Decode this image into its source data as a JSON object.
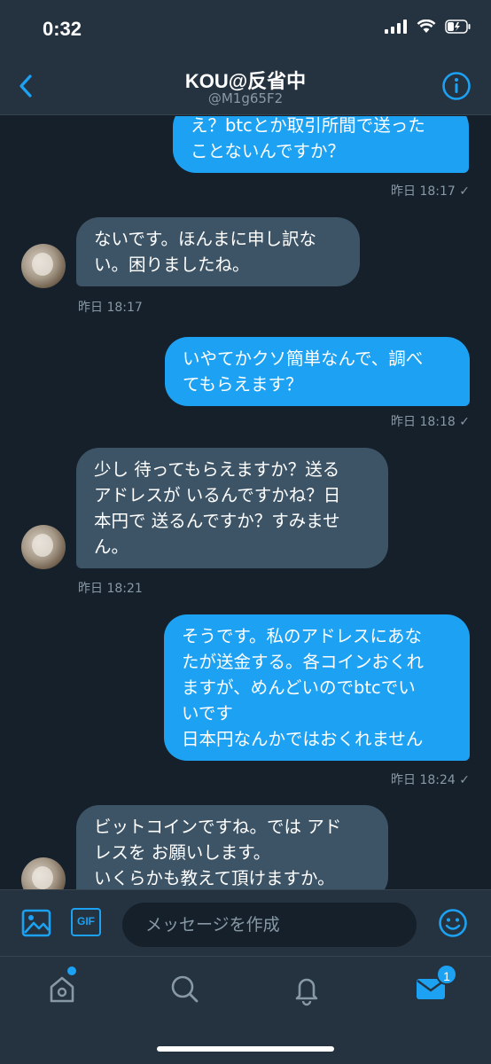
{
  "status": {
    "time": "0:32"
  },
  "header": {
    "title": "KOU@反省中",
    "handle": "@M1g65F2"
  },
  "messages": [
    {
      "dir": "out",
      "text": "え？btcとか取引所間で送った\nことないんですか？",
      "time": "昨日 18:17"
    },
    {
      "dir": "in",
      "text": "ないです。ほんまに申し訳な\nい。困りましたね。",
      "time": "昨日 18:17"
    },
    {
      "dir": "out",
      "text": "いやてかクソ簡単なんで、調べ\nてもらえます？",
      "time": "昨日 18:18"
    },
    {
      "dir": "in",
      "text": "少し 待ってもらえますか？送る\nアドレスが いるんですかね？日\n本円で 送るんですか？すみませ\nん。",
      "time": "昨日 18:21"
    },
    {
      "dir": "out",
      "text": "そうです。私のアドレスにあな\nたが送金する。各コインおくれ\nますが、めんどいのでbtcでい\nいです\n日本円なんかではおくれません",
      "time": "昨日 18:24"
    },
    {
      "dir": "in",
      "text": "ビットコインですね。では アド\nレスを お願いします。\nいくらかも教えて頂けますか。",
      "time": ""
    }
  ],
  "composer": {
    "placeholder": "メッセージを作成",
    "gif_label": "GIF"
  },
  "tabbar": {
    "messages_badge": "1"
  },
  "colors": {
    "accent": "#1da1f2",
    "bg": "#15202b",
    "bar": "#253341",
    "incoming": "#3d5466"
  },
  "icons": [
    "back-arrow-icon",
    "info-icon",
    "image-icon",
    "gif-icon",
    "emoji-icon",
    "home-icon",
    "search-icon",
    "bell-icon",
    "mail-icon"
  ]
}
